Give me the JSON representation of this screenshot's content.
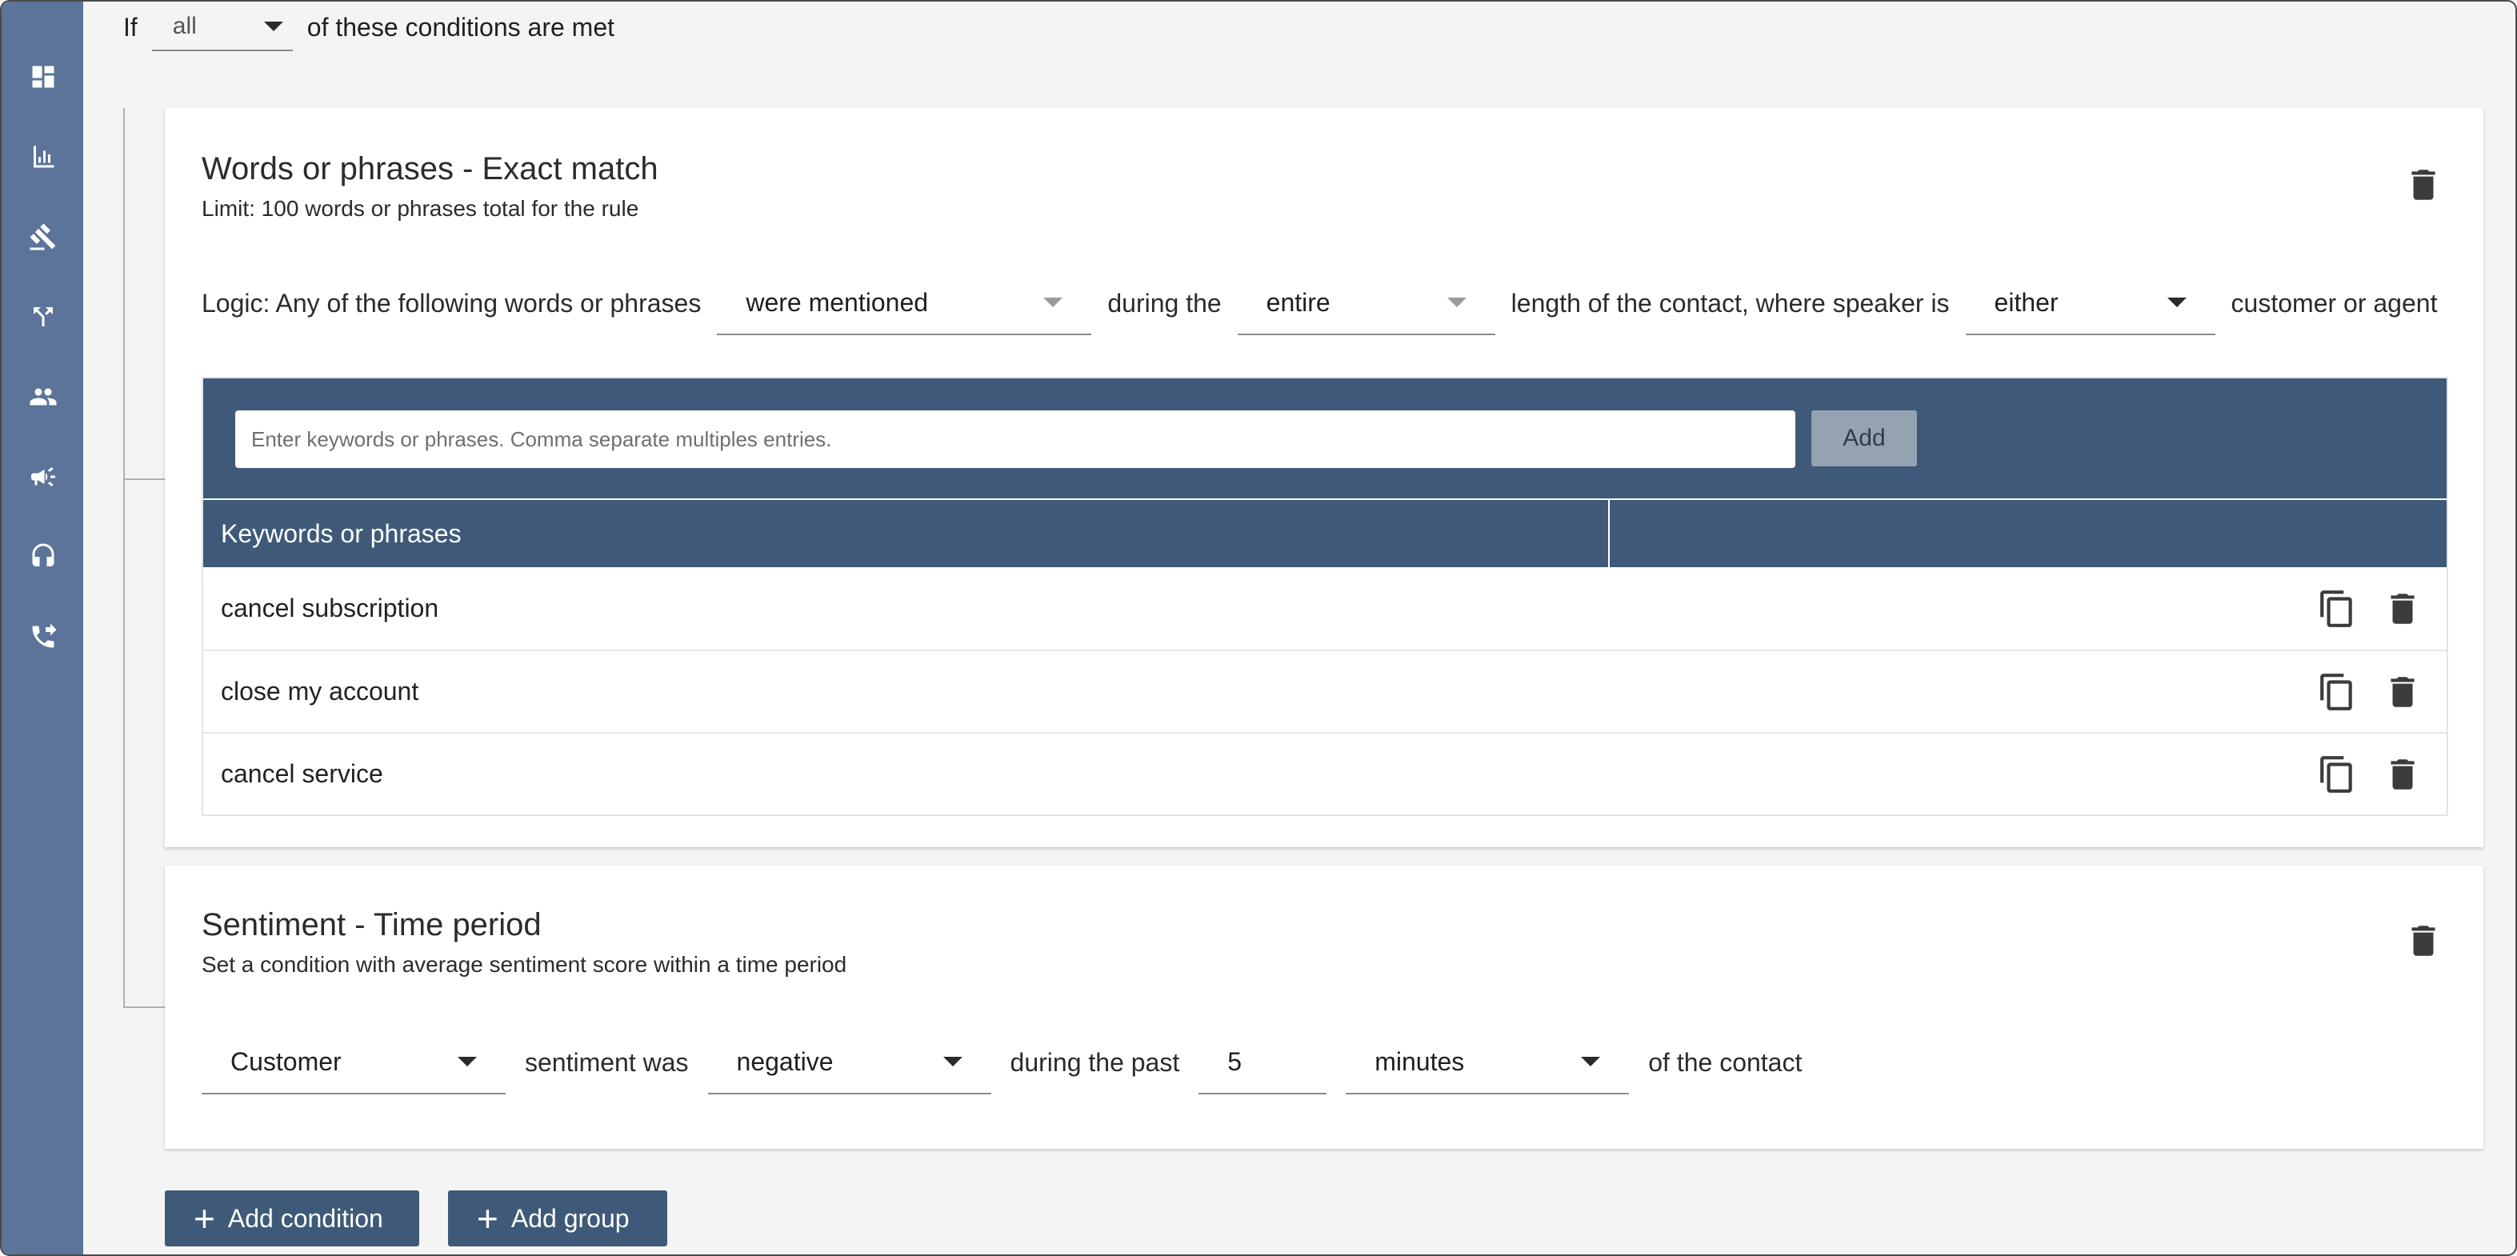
{
  "header": {
    "if_label": "If",
    "match_select": "all",
    "suffix": "of these conditions are met"
  },
  "sidebar": {
    "items": [
      {
        "icon": "dashboard-icon"
      },
      {
        "icon": "bar-chart-icon"
      },
      {
        "icon": "gavel-icon"
      },
      {
        "icon": "call-split-icon"
      },
      {
        "icon": "people-icon"
      },
      {
        "icon": "campaign-icon"
      },
      {
        "icon": "headset-icon"
      },
      {
        "icon": "phone-forward-icon"
      }
    ]
  },
  "words_card": {
    "title": "Words or phrases - Exact match",
    "subtitle": "Limit: 100 words or phrases total for the rule",
    "logic": {
      "prefix": "Logic: Any of the following words or phrases",
      "mention_select": "were mentioned",
      "during_label": "during the",
      "period_select": "entire",
      "length_label": "length of the contact, where speaker is",
      "speaker_select": "either",
      "suffix": "customer or agent"
    },
    "input_placeholder": "Enter keywords or phrases. Comma separate multiples entries.",
    "add_label": "Add",
    "column_header": "Keywords or phrases",
    "keywords": [
      "cancel subscription",
      "close my account",
      "cancel service"
    ]
  },
  "sentiment_card": {
    "title": "Sentiment - Time period",
    "subtitle": "Set a condition with average sentiment score within a time period",
    "speaker_select": "Customer",
    "sentiment_label": "sentiment was",
    "sentiment_select": "negative",
    "during_label": "during the past",
    "amount": "5",
    "unit_select": "minutes",
    "suffix": "of the contact"
  },
  "actions": {
    "add_condition": "Add condition",
    "add_group": "Add group"
  },
  "colors": {
    "sidebar": "#5c7499",
    "header_dark": "#3e5a78",
    "add_disabled": "#94a2b2",
    "page_bg": "#f4f4f4"
  }
}
